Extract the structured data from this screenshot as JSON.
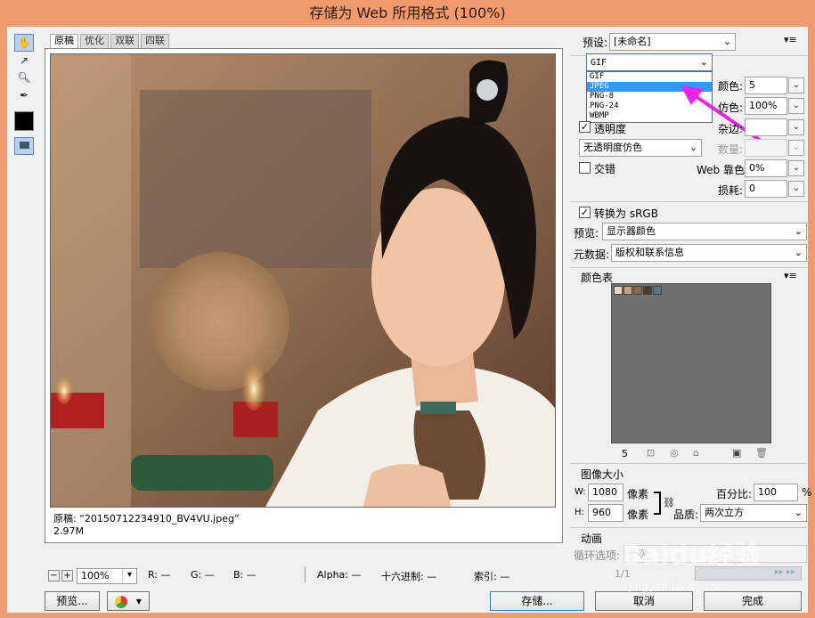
{
  "window": {
    "title": "存储为 Web 所用格式 (100%)"
  },
  "tabs": [
    "原稿",
    "优化",
    "双联",
    "四联"
  ],
  "image_info": {
    "line1": "原稿: “20150712234910_BV4VU.jpeg”",
    "line2": "2.97M"
  },
  "status": {
    "zoom": "100%",
    "r": "R: —",
    "g": "G: —",
    "b": "B: —",
    "alpha": "Alpha: —",
    "hex": "十六进制: —",
    "index": "索引: —"
  },
  "bottom": {
    "preview": "预览...",
    "save": "存储...",
    "cancel": "取消",
    "done": "完成"
  },
  "settings": {
    "preset_label": "预设:",
    "preset_value": "[未命名]",
    "format_value": "GIF",
    "format_options": [
      "GIF",
      "JPEG",
      "PNG-8",
      "PNG-24",
      "WBMP"
    ],
    "colors_label": "颜色:",
    "colors_value": "5",
    "dither_label": "仿色:",
    "dither_value": "100%",
    "matte_label": "杂边:",
    "transparency_label": "透明度",
    "transparency_dither": "无透明度仿色",
    "amount_label": "数量:",
    "interlaced_label": "交错",
    "websnap_label": "Web 靠色:",
    "websnap_value": "0%",
    "lossy_label": "损耗:",
    "lossy_value": "0",
    "convert_srgb_label": "转换为 sRGB",
    "preview_label": "预览:",
    "preview_value": "显示器颜色",
    "metadata_label": "元数据:",
    "metadata_value": "版权和联系信息"
  },
  "color_table": {
    "title": "颜色表",
    "count": "5",
    "swatches": [
      "#f0d8c0",
      "#c8a080",
      "#8a6848",
      "#4a3a30",
      "#607080"
    ]
  },
  "image_size": {
    "title": "图像大小",
    "w_label": "W:",
    "w_value": "1080",
    "h_label": "H:",
    "h_value": "960",
    "unit": "像素",
    "percent_label": "百分比:",
    "percent_value": "100",
    "percent_unit": "%",
    "quality_label": "品质:",
    "quality_value": "两次立方"
  },
  "animation": {
    "title": "动画",
    "loop_label": "循环选项:",
    "loop_value": "一次",
    "frame": "1/1"
  },
  "watermark": {
    "brand": "Baidu经验",
    "url": "jingyan.baidu.com"
  },
  "colors": {
    "title_bar": "#ef9a6c",
    "arrow": "#ee22ee",
    "highlight": "#3399ff"
  }
}
